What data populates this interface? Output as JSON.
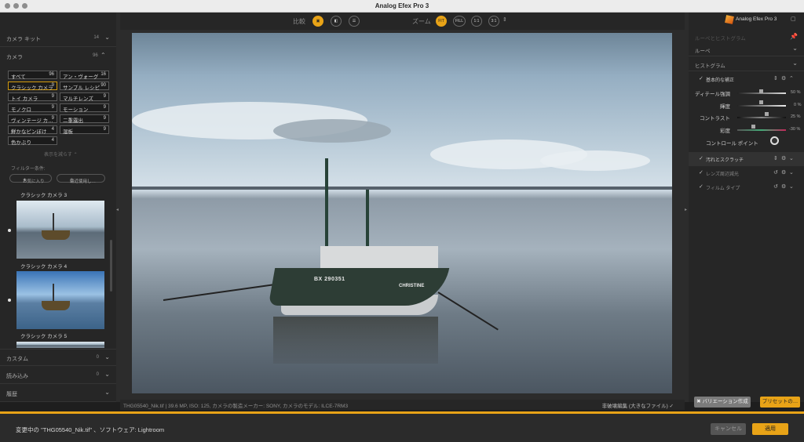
{
  "window": {
    "title": "Analog Efex Pro 3"
  },
  "left_panel": {
    "camera_kit": {
      "label": "カメラ キット",
      "count": "14"
    },
    "camera": {
      "label": "カメラ",
      "count": "96"
    },
    "categories": [
      {
        "label": "すべて",
        "count": "96",
        "selected": false
      },
      {
        "label": "アン・ヴォーグ",
        "count": "16",
        "selected": false
      },
      {
        "label": "クラシック カメラ",
        "count": "9",
        "selected": true
      },
      {
        "label": "サンプル レシピ",
        "count": "90",
        "selected": false
      },
      {
        "label": "トイ カメラ",
        "count": "9",
        "selected": false
      },
      {
        "label": "マルチレンズ",
        "count": "9",
        "selected": false
      },
      {
        "label": "モノクロ",
        "count": "9",
        "selected": false
      },
      {
        "label": "モーション",
        "count": "9",
        "selected": false
      },
      {
        "label": "ヴィンテージ カ…",
        "count": "9",
        "selected": false
      },
      {
        "label": "二重露出",
        "count": "9",
        "selected": false
      },
      {
        "label": "鮮かなピンぼけ",
        "count": "4",
        "selected": false
      },
      {
        "label": "湿板",
        "count": "9",
        "selected": false
      },
      {
        "label": "色かぶり",
        "count": "4",
        "selected": false
      }
    ],
    "show_less": "表示を減らす",
    "filter_label": "フィルター条件:",
    "filter_favorites": "お気に入り",
    "filter_recent": "最近使用し…",
    "presets": [
      {
        "name": "クラシック カメラ 3"
      },
      {
        "name": "クラシック カメラ 4"
      },
      {
        "name": "クラシック カメラ 5"
      }
    ],
    "custom": {
      "label": "カスタム",
      "count": "0"
    },
    "import": {
      "label": "読み込み",
      "count": "0"
    },
    "history": {
      "label": "履歴"
    }
  },
  "toolbar": {
    "compare_label": "比較",
    "zoom_label": "ズーム",
    "zoom_buttons": [
      "FIT",
      "FILL",
      "1:1",
      "3:1"
    ],
    "zoom_selected": "FIT"
  },
  "photo": {
    "registration": "BX 290351",
    "ship_name": "CHRISTINE"
  },
  "info_bar": {
    "info": "THG05540_Nik.tif  |  39.6 MP, ISO: 125, カメラの製造メーカー: SONY, カメラのモデル: ILCE-7RM3",
    "hq_label": "非破壊編集 (大きなファイル)"
  },
  "right_panel": {
    "app_name": "Analog Efex Pro 3",
    "loupe_hist": "ルーペとヒストグラム",
    "loupe": "ルーペ",
    "histogram": "ヒストグラム",
    "basic": "基本的な補正",
    "sliders": [
      {
        "label": "ディテール強調",
        "value": "50 %"
      },
      {
        "label": "輝度",
        "value": "0 %"
      },
      {
        "label": "コントラスト",
        "value": "25 %"
      },
      {
        "label": "彩度",
        "value": "-30 %"
      }
    ],
    "control_point": "コントロール ポイント",
    "sections": [
      {
        "label": "汚れとスクラッチ"
      },
      {
        "label": "レンズ周辺減光"
      },
      {
        "label": "フィルム タイプ"
      }
    ],
    "variation_btn": "バリエーション作成",
    "preset_btn": "プリセットの…"
  },
  "bottom_bar": {
    "status": "変更中の \"THG05540_Nik.tif\" 、ソフトウェア: Lightroom",
    "cancel": "キャンセル",
    "apply": "適用"
  },
  "colors": {
    "accent": "#e8a317",
    "panel": "#262626",
    "background": "#1e1e1e"
  }
}
